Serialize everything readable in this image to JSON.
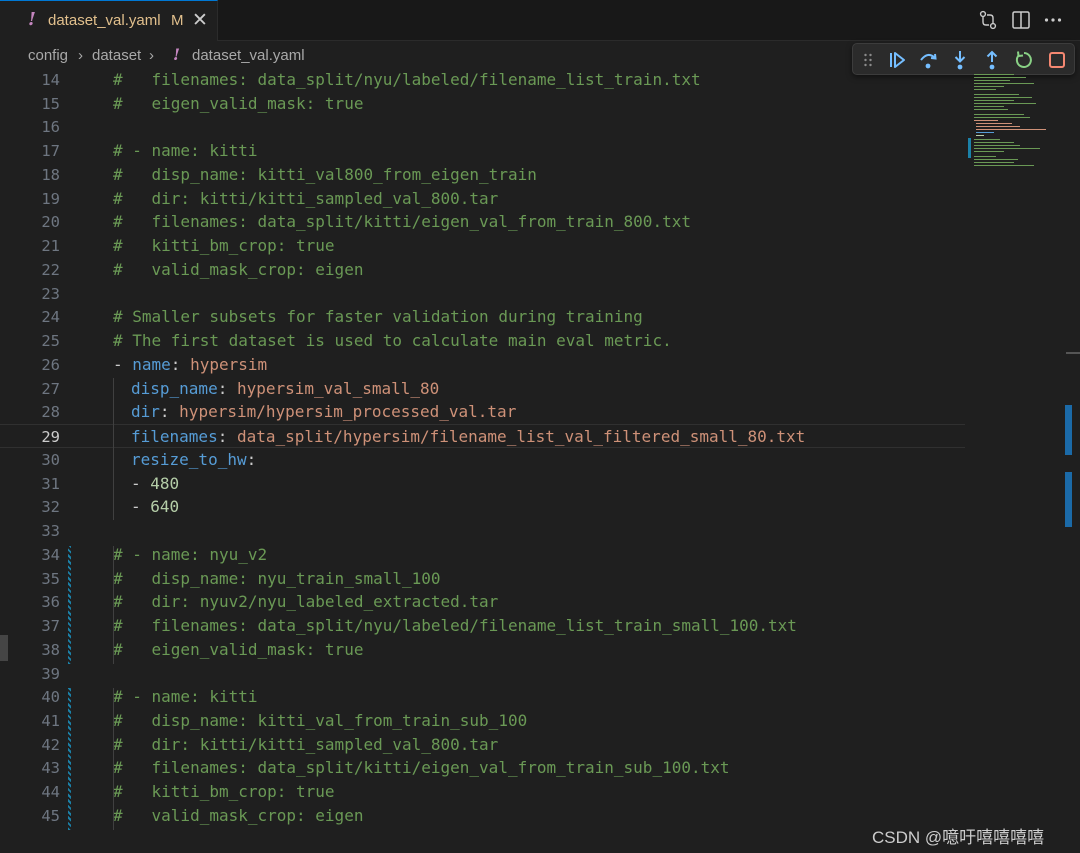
{
  "tab": {
    "icon": "yaml-exclamation-icon",
    "name": "dataset_val.yaml",
    "badge": "M",
    "close_glyph": "✕"
  },
  "top_actions": [
    "compare-changes-icon",
    "split-editor-icon",
    "more-actions-icon"
  ],
  "breadcrumb": {
    "items": [
      "config",
      "dataset",
      "dataset_val.yaml"
    ],
    "separator": "›",
    "file_icon": "!"
  },
  "debug_toolbar": {
    "buttons": [
      "continue",
      "step-over",
      "step-into",
      "step-out",
      "restart",
      "stop"
    ],
    "colors": {
      "blue": "#75beff",
      "green": "#89d185",
      "red": "#f48771"
    }
  },
  "editor": {
    "current_line": 29,
    "lines": [
      {
        "n": "14",
        "t": "comment",
        "text": "#   filenames: data_split/nyu/labeled/filename_list_train.txt"
      },
      {
        "n": "15",
        "t": "comment",
        "text": "#   eigen_valid_mask: true"
      },
      {
        "n": "16",
        "t": "blank",
        "text": ""
      },
      {
        "n": "17",
        "t": "comment",
        "text": "# - name: kitti"
      },
      {
        "n": "18",
        "t": "comment",
        "text": "#   disp_name: kitti_val800_from_eigen_train"
      },
      {
        "n": "19",
        "t": "comment",
        "text": "#   dir: kitti/kitti_sampled_val_800.tar"
      },
      {
        "n": "20",
        "t": "comment",
        "text": "#   filenames: data_split/kitti/eigen_val_from_train_800.txt"
      },
      {
        "n": "21",
        "t": "comment",
        "text": "#   kitti_bm_crop: true"
      },
      {
        "n": "22",
        "t": "comment",
        "text": "#   valid_mask_crop: eigen"
      },
      {
        "n": "23",
        "t": "blank",
        "text": ""
      },
      {
        "n": "24",
        "t": "comment",
        "text": "# Smaller subsets for faster validation during training"
      },
      {
        "n": "25",
        "t": "comment",
        "text": "# The first dataset is used to calculate main eval metric."
      },
      {
        "n": "26",
        "t": "item",
        "key": "name",
        "val": "hypersim"
      },
      {
        "n": "27",
        "t": "kv",
        "key": "disp_name",
        "val": "hypersim_val_small_80"
      },
      {
        "n": "28",
        "t": "kv",
        "key": "dir",
        "val": "hypersim/hypersim_processed_val.tar"
      },
      {
        "n": "29",
        "t": "kv",
        "key": "filenames",
        "val": "data_split/hypersim/filename_list_val_filtered_small_80.txt"
      },
      {
        "n": "30",
        "t": "key",
        "key": "resize_to_hw",
        "val": ""
      },
      {
        "n": "31",
        "t": "num",
        "key": "",
        "val": "480"
      },
      {
        "n": "32",
        "t": "num",
        "key": "",
        "val": "640"
      },
      {
        "n": "33",
        "t": "blank",
        "text": ""
      },
      {
        "n": "34",
        "t": "comment",
        "text": "# - name: nyu_v2"
      },
      {
        "n": "35",
        "t": "comment",
        "text": "#   disp_name: nyu_train_small_100"
      },
      {
        "n": "36",
        "t": "comment",
        "text": "#   dir: nyuv2/nyu_labeled_extracted.tar"
      },
      {
        "n": "37",
        "t": "comment",
        "text": "#   filenames: data_split/nyu/labeled/filename_list_train_small_100.txt"
      },
      {
        "n": "38",
        "t": "comment",
        "text": "#   eigen_valid_mask: true"
      },
      {
        "n": "39",
        "t": "blank",
        "text": ""
      },
      {
        "n": "40",
        "t": "comment",
        "text": "# - name: kitti"
      },
      {
        "n": "41",
        "t": "comment",
        "text": "#   disp_name: kitti_val_from_train_sub_100"
      },
      {
        "n": "42",
        "t": "comment",
        "text": "#   dir: kitti/kitti_sampled_val_800.tar"
      },
      {
        "n": "43",
        "t": "comment",
        "text": "#   filenames: data_split/kitti/eigen_val_from_train_sub_100.txt"
      },
      {
        "n": "44",
        "t": "comment",
        "text": "#   kitti_bm_crop: true"
      },
      {
        "n": "45",
        "t": "comment",
        "text": "#   valid_mask_crop: eigen"
      }
    ]
  },
  "watermark": "CSDN @噫吁嘻嘻嘻嘻",
  "colors": {
    "comment": "#6a9955",
    "key": "#569cd6",
    "string": "#ce9178",
    "number": "#b5cea8",
    "modified": "#e2c08d",
    "accent": "#0078d4"
  }
}
